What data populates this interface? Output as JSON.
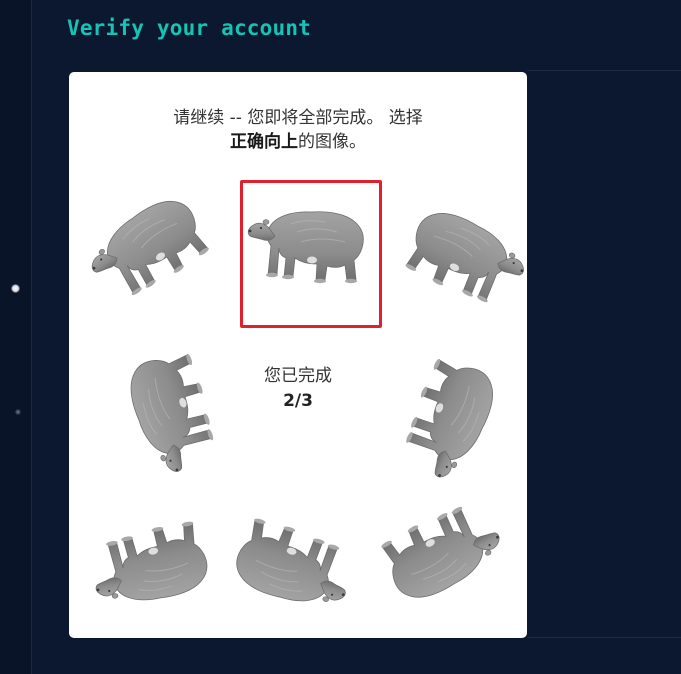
{
  "page": {
    "title": "Verify your account"
  },
  "challenge": {
    "prompt_line1": "请继续 -- 您即将全部完成。 选择",
    "prompt_bold": "正确向上",
    "prompt_tail": "的图像。",
    "progress_label": "您已完成",
    "progress_count": "2/3"
  },
  "tiles": [
    {
      "name": "bear-tile-1",
      "rotation_deg": -35,
      "selected": false
    },
    {
      "name": "bear-tile-2",
      "rotation_deg": 0,
      "selected": true
    },
    {
      "name": "bear-tile-3",
      "rotation_deg": 30,
      "selected": false
    },
    {
      "name": "bear-tile-4",
      "rotation_deg": -110,
      "selected": false
    },
    {
      "name": "bear-tile-6",
      "rotation_deg": 115,
      "selected": false
    },
    {
      "name": "bear-tile-7",
      "rotation_deg": 170,
      "selected": false
    },
    {
      "name": "bear-tile-8",
      "rotation_deg": -165,
      "selected": false
    },
    {
      "name": "bear-tile-9",
      "rotation_deg": 150,
      "selected": false
    }
  ],
  "colors": {
    "background": "#0c1730",
    "title": "#14c4b4",
    "selection_border": "#e0202d",
    "bear_fill": "#8f8f8f"
  }
}
